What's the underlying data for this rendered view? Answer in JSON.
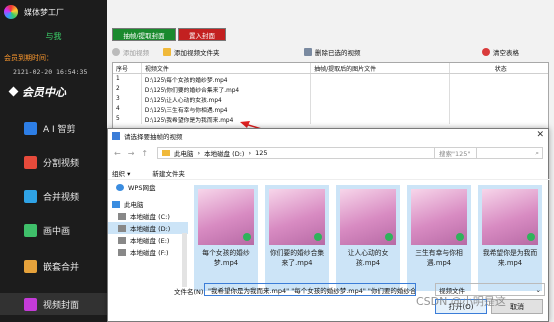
{
  "app": {
    "title": "媒体梦工厂"
  },
  "sidebar": {
    "greeting": "与我",
    "expire_label": "会员到期时间：",
    "expire_value": "2121-02-20 16:54:35",
    "member_center": "会员中心",
    "items": [
      {
        "label": "A I 智剪",
        "icon": "ai-icon",
        "color": "#2d7ee6"
      },
      {
        "label": "分割视频",
        "icon": "split-video-icon",
        "color": "#e64a3b"
      },
      {
        "label": "合并视频",
        "icon": "merge-video-icon",
        "color": "#2fa3e6"
      },
      {
        "label": "画中画",
        "icon": "picture-in-picture-icon",
        "color": "#3fbf6a"
      },
      {
        "label": "嵌套合并",
        "icon": "nested-merge-icon",
        "color": "#e6a23b"
      },
      {
        "label": "视频封面",
        "icon": "video-cover-icon",
        "color": "#c43bd8"
      }
    ],
    "active_index": 5
  },
  "main": {
    "extract_button": "抽帧/提取封面",
    "cover_button": "置入封面",
    "toolbar": {
      "add_video": "添加视频",
      "add_folder": "添加视频文件夹",
      "delete_selected": "删除已选的视频",
      "clear_table": "清空表格"
    },
    "table": {
      "headers": [
        "序号",
        "视频文件",
        "抽帧/提取后的图片文件",
        "状态"
      ],
      "rows": [
        [
          "1",
          "D:\\125\\每个女孩的婚纱梦.mp4",
          "",
          ""
        ],
        [
          "2",
          "D:\\125\\你们要的婚纱合集来了.mp4",
          "",
          ""
        ],
        [
          "3",
          "D:\\125\\让人心动的女孩.mp4",
          "",
          ""
        ],
        [
          "4",
          "D:\\125\\三生有幸与你相遇.mp4",
          "",
          ""
        ],
        [
          "5",
          "D:\\125\\我希望你是为我而来.mp4",
          "",
          ""
        ]
      ]
    }
  },
  "dialog": {
    "title": "请选择要抽帧的视频",
    "path": [
      "此电脑",
      "本地磁盘 (D:)",
      "125"
    ],
    "search_placeholder": "搜索\"125\"",
    "organize": "组织 ▾",
    "new_folder": "新建文件夹",
    "tree": [
      {
        "label": "WPS网盘",
        "selected": false
      },
      {
        "label": "此电脑",
        "selected": false
      },
      {
        "label": "本地磁盘 (C:)",
        "selected": false
      },
      {
        "label": "本地磁盘 (D:)",
        "selected": true
      },
      {
        "label": "本地磁盘 (E:)",
        "selected": false
      },
      {
        "label": "本地磁盘 (F:)",
        "selected": false
      }
    ],
    "files": [
      "每个女孩的婚纱梦.mp4",
      "你们要的婚纱合集来了.mp4",
      "让人心动的女孩.mp4",
      "三生有幸与你相遇.mp4",
      "我希望你是为我而来.mp4"
    ],
    "filename_label": "文件名(N):",
    "filename_value": "\"我希望你是为我而来.mp4\" \"每个女孩的婚纱梦.mp4\" \"你们要的婚纱合",
    "filetype": "视频文件",
    "open": "打开(O)",
    "cancel": "取消"
  },
  "watermark": "CSDN @小明是这"
}
